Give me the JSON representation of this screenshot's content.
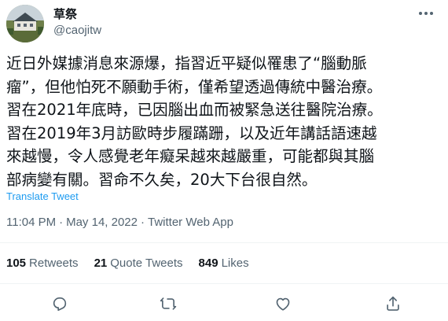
{
  "author": {
    "display_name": "草祭",
    "handle": "@caojitw",
    "avatar_icon": "house-landscape-avatar"
  },
  "tweet": {
    "text": "近日外媒據消息來源爆，指習近平疑似罹患了“腦動脈\n瘤”，但他怕死不願動手術，僅希望透過傳統中醫治療。\n習在2021年底時，已因腦出血而被緊急送往醫院治療。\n習在2019年3月訪歐時步履蹣跚，以及近年講話語速越\n來越慢，令人感覺老年癡呆越來越嚴重，可能都與其腦\n部病變有關。習命不久矣，20大下台很自然。",
    "translate_label": "Translate Tweet"
  },
  "meta": {
    "time": "11:04 PM",
    "separator": "·",
    "date": "May 14, 2022",
    "source": "Twitter Web App"
  },
  "stats": {
    "retweets_count": "105",
    "retweets_label": "Retweets",
    "quotes_count": "21",
    "quotes_label": "Quote Tweets",
    "likes_count": "849",
    "likes_label": "Likes"
  },
  "actions": {
    "icons": [
      "reply-icon",
      "retweet-icon",
      "like-icon",
      "share-icon"
    ]
  },
  "colors": {
    "text": "#0f1419",
    "secondary": "#536471",
    "link": "#1d9bf0",
    "divider": "#eff3f4"
  }
}
